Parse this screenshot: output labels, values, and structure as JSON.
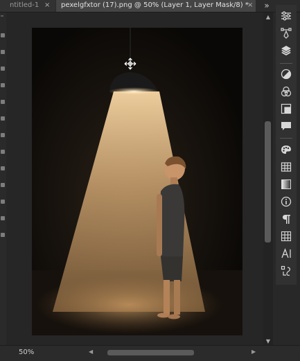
{
  "tabs": [
    {
      "label": "ntitled-1",
      "close": "×"
    },
    {
      "label": "pexelgfxtor (17).png @ 50% (Layer 1, Layer Mask/8) *",
      "close": "×"
    }
  ],
  "tab_overflow": "»",
  "status": {
    "zoom": "50%"
  },
  "scrollbar_arrows": {
    "up": "▲",
    "down": "▼",
    "left": "◀",
    "right": "▶"
  },
  "colors": {
    "background": "#282828",
    "panel": "#313131",
    "active_tab": "#454545",
    "light_beam": "#f0c48a",
    "lamp_glow": "#fff0c8"
  },
  "right_panel_icons": [
    "sliders-icon",
    "pen-path-icon",
    "layers-icon",
    "adjustment-icon",
    "channels-icon",
    "navigator-icon",
    "comment-icon",
    "swatches-icon",
    "table-grid-icon",
    "gradient-icon",
    "info-icon",
    "paragraph-icon",
    "glyphs-grid-icon",
    "character-icon",
    "clone-source-icon"
  ]
}
